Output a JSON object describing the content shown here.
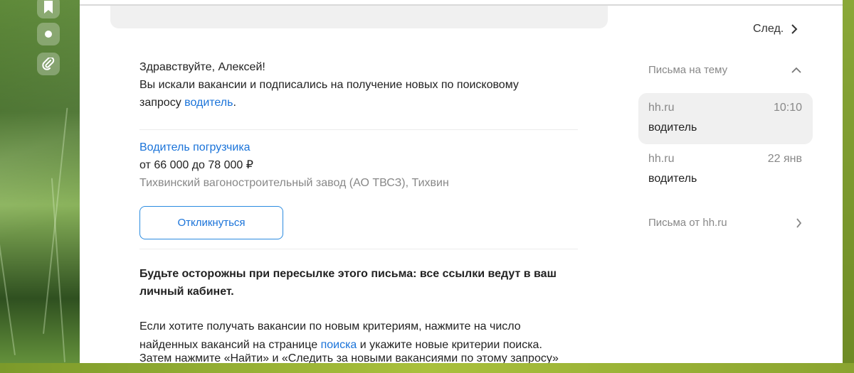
{
  "left_rail": {
    "icons": [
      "bookmark-icon",
      "dot-icon",
      "attachment-icon"
    ]
  },
  "nav": {
    "next_label": "След."
  },
  "email": {
    "greeting": "Здравствуйте, Алексей!",
    "line1": "Вы искали вакансии и подписались на получение новых по поисковому",
    "line2_prefix": "запросу ",
    "query_link": "водитель",
    "line2_suffix": ".",
    "vacancy": {
      "title": "Водитель погрузчика",
      "salary": "от 66 000 до 78 000 ₽",
      "company": "Тихвинский вагоностроительный завод (АО ТВСЗ), Тихвин",
      "respond_label": "Откликнуться"
    },
    "warning_line1": "Будьте осторожны при пересылке этого письма: все ссылки ведут в ваш",
    "warning_line2": "личный кабинет.",
    "criteria_line1": "Если хотите получать вакансии по новым критериям, нажмите на число",
    "criteria_line2_prefix": "найденных вакансий на странице ",
    "search_link": "поиска",
    "criteria_line2_suffix": " и укажите новые критерии поиска.",
    "criteria_line3": "Затем нажмите «Найти» и «Следить за новыми вакансиями по этому запросу»"
  },
  "thread": {
    "header": "Письма на тему",
    "items": [
      {
        "sender": "hh.ru",
        "time": "10:10",
        "subject": "водитель"
      },
      {
        "sender": "hh.ru",
        "time": "22 янв",
        "subject": "водитель"
      }
    ],
    "from_label": "Письма от hh.ru"
  },
  "colors": {
    "link": "#1a73d9",
    "selected_bg": "#f0f0f0"
  }
}
